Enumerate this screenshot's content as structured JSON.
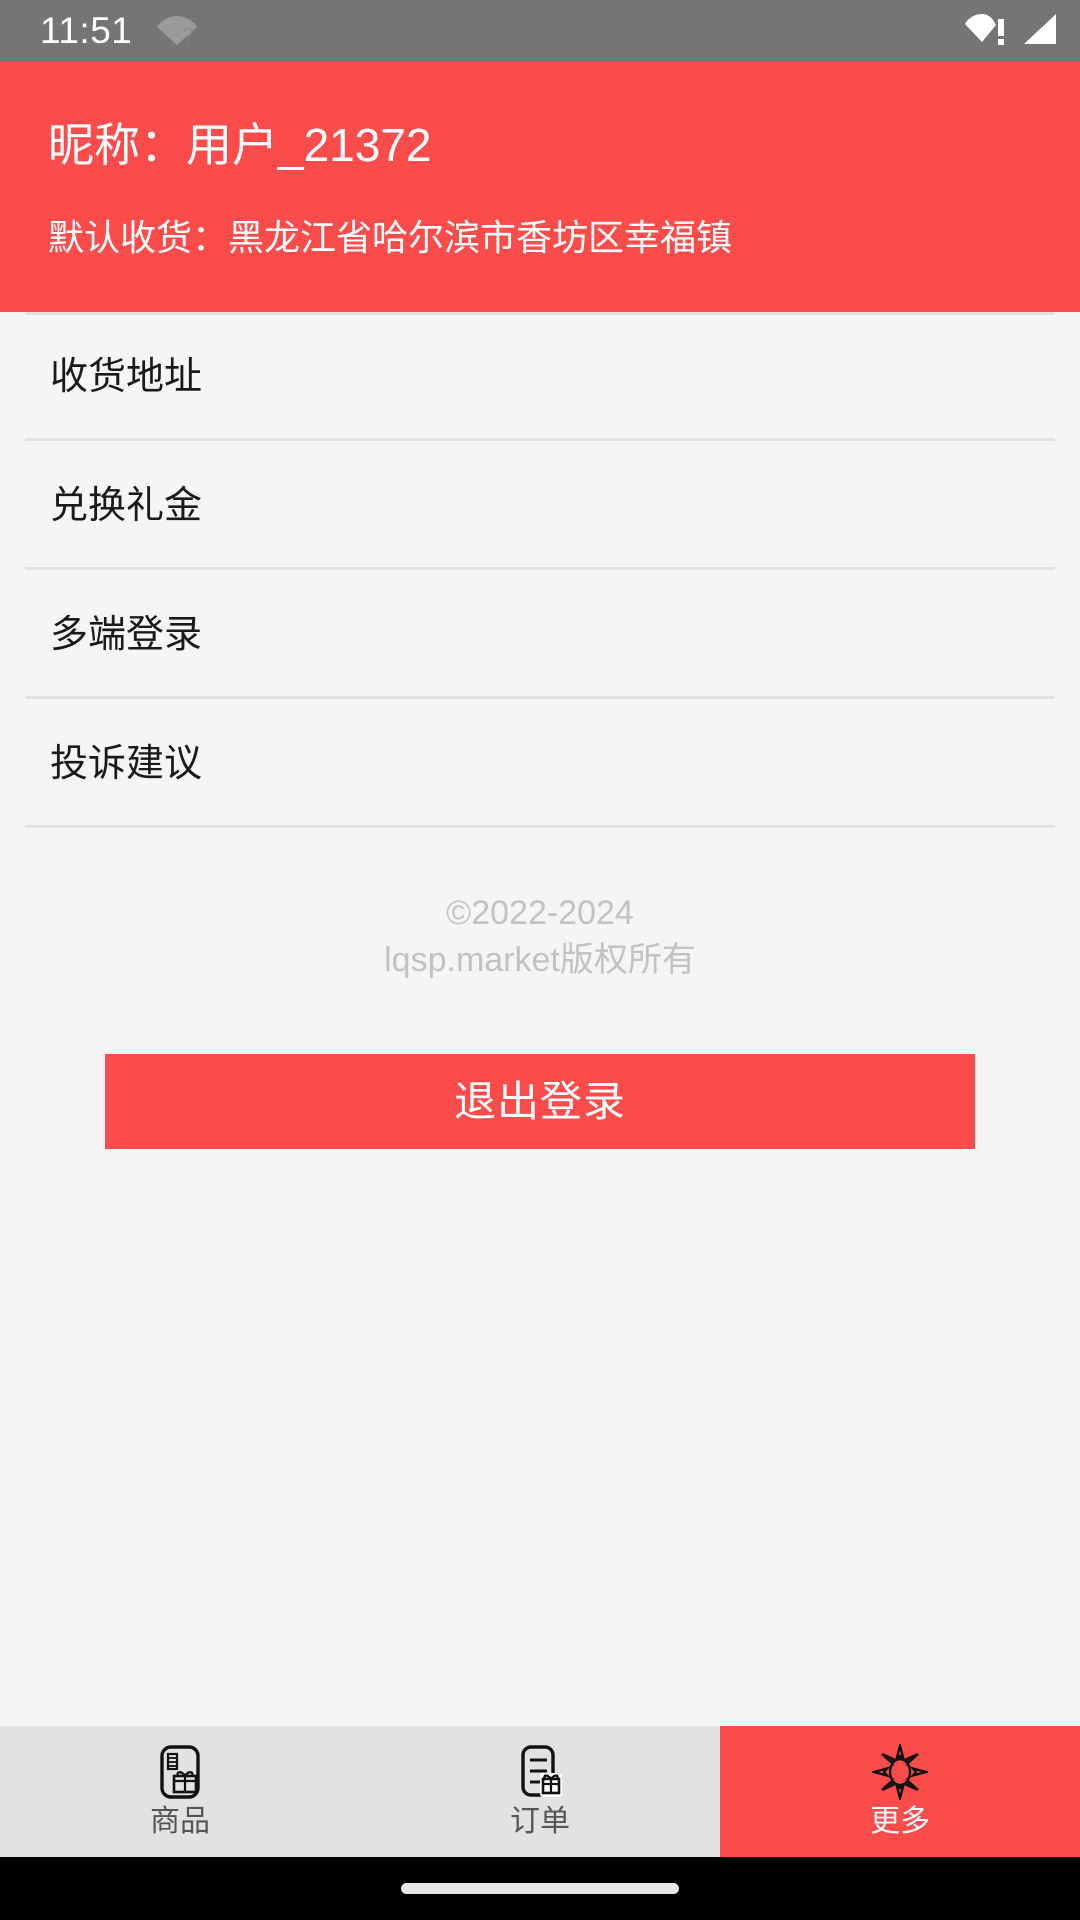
{
  "theme": {
    "accent": "#FB4C4C",
    "page_bg": "#F5F5F5",
    "statusbar_bg": "#757575",
    "nav_bg": "#E2E2E2",
    "divider": "#E2E2E2",
    "muted_text": "#C2C2C2"
  },
  "statusbar": {
    "clock": "11:51",
    "left_icons": [
      "wifi-question-icon"
    ],
    "right_icons": [
      "wifi-warning-icon",
      "signal-bars-icon"
    ]
  },
  "header": {
    "nickname": "昵称：用户_21372",
    "default_address": "默认收货：黑龙江省哈尔滨市香坊区幸福镇"
  },
  "menu": {
    "items": [
      {
        "label": "收货地址",
        "name": "shipping-address"
      },
      {
        "label": "兑换礼金",
        "name": "redeem-gift"
      },
      {
        "label": "多端登录",
        "name": "multi-device-login"
      },
      {
        "label": "投诉建议",
        "name": "complaints-suggestions"
      }
    ]
  },
  "footer": {
    "copyright_line1": "©2022-2024",
    "copyright_line2": "lqsp.market版权所有",
    "logout_label": "退出登录"
  },
  "bottom_nav": {
    "items": [
      {
        "label": "商品",
        "icon": "card-gift-icon",
        "active": false
      },
      {
        "label": "订单",
        "icon": "order-list-gift-icon",
        "active": false
      },
      {
        "label": "更多",
        "icon": "sunburst-icon",
        "active": true
      }
    ]
  },
  "gesture_bar": {
    "handle": "home-indicator"
  }
}
